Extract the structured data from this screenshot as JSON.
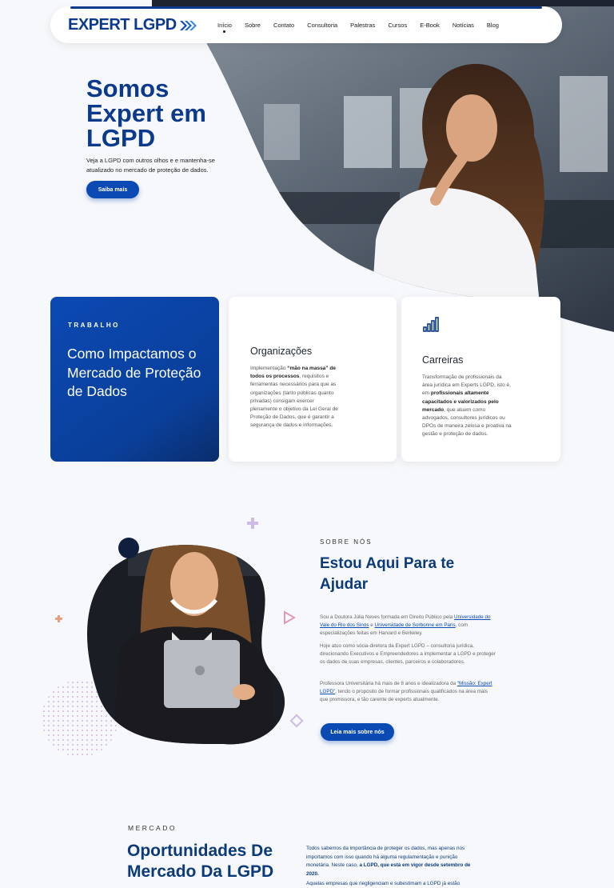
{
  "brand": {
    "name": "EXPERT LGPD",
    "primary_color": "#0b49b3",
    "dark_color": "#0b3a7a"
  },
  "nav": {
    "items": [
      {
        "label": "Início",
        "active": true
      },
      {
        "label": "Sobre",
        "active": false
      },
      {
        "label": "Contato",
        "active": false
      },
      {
        "label": "Consultoria",
        "active": false
      },
      {
        "label": "Palestras",
        "active": false
      },
      {
        "label": "Cursos",
        "active": false
      },
      {
        "label": "E-Book",
        "active": false
      },
      {
        "label": "Notícias",
        "active": false
      },
      {
        "label": "Blog",
        "active": false
      }
    ]
  },
  "hero": {
    "title_line1": "Somos",
    "title_line2": "Expert em",
    "title_line3": "LGPD",
    "subtitle": "Veja a LGPD com outros olhos e e mantenha-se atualizado no mercado de proteção de dados.",
    "button": "Saiba mais"
  },
  "cards": {
    "intro": {
      "kicker": "TRABALHO",
      "title": "Como Impactamos o Mercado de Proteção de Dados"
    },
    "organizacoes": {
      "title": "Organizações",
      "text_before": "Implementação ",
      "text_bold": "“mão na massa” de todos os processos",
      "text_after": ", requisitos e ferramentas necessários para que as organizações (tanto públicas quanto privadas) consigam exercer plenamente o objetivo da Lei Geral de Proteção de Dados, que é garantir a segurança de dados e informações."
    },
    "carreiras": {
      "icon": "bar-chart-icon",
      "title": "Carreiras",
      "text_before": "Transformação de profissionais da área jurídica em Experts LGPD, isto é, em ",
      "text_bold": "profissionais altamente capacitados e valorizados pelo mercado",
      "text_after": ", que atuem como advogados, consultores jurídicos ou DPOs de maneira zelosa e proativa na gestão e proteção de dados."
    }
  },
  "about": {
    "kicker": "SOBRE NÓS",
    "title": "Estou Aqui Para te Ajudar",
    "p1_a": "Sou a Doutora Júlia Neves formada em Direito Público pela ",
    "p1_link1": "Universidade do Vale do Rio dos Sinos",
    "p1_b": " e ",
    "p1_link2": "Universidade de Sorbonne em Paris",
    "p1_c": ", com especializações feitas em Harvard e Berkeley.",
    "p2": "Hoje atuo como sócia-diretora da Expert LGPD – consultoria jurídica, direcionando Executivos e Empreendedores a implementar a LGPD e proteger os dados de suas empresas, clientes, parceiros e colaboradores.",
    "p3_a": "Professora Universitária há mais de 8 anos e idealizadora da ",
    "p3_link": "“Missão: Expert LGPD”",
    "p3_b": ", tendo o propósito de formar profissionais qualificados na área mais que promissora, e tão carente de experts atualmente.",
    "button": "Leia mais sobre nós"
  },
  "market": {
    "kicker": "MERCADO",
    "title": "Oportunidades De Mercado Da LGPD",
    "p1_a": "Todos sabemos da importância de proteger os dados, mas apenas nos importamos com isso quando há alguma regulamentação e punição monetária. Neste caso, ",
    "p1_bold": "a LGPD, que está em vigor desde setembro de 2020.",
    "p2": "Aquelas empresas que negligenciam e subestimam a LGPD já estão"
  }
}
